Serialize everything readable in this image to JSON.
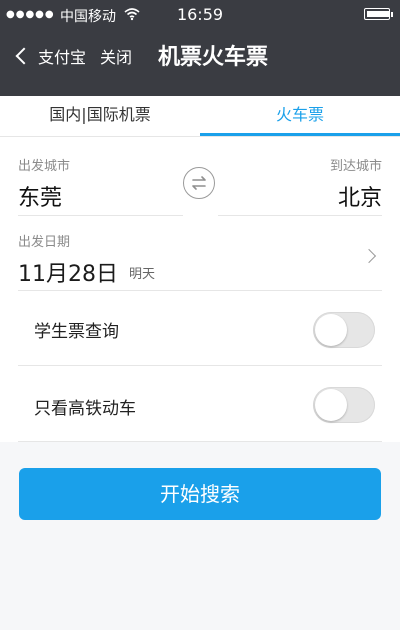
{
  "status_bar": {
    "signal_dots": "●●●●●",
    "carrier": "中国移动",
    "time": "16:59"
  },
  "nav": {
    "back_label": "支付宝",
    "close_label": "关闭",
    "title": "机票火车票"
  },
  "tabs": [
    {
      "label": "国内|国际机票",
      "active": false
    },
    {
      "label": "火车票",
      "active": true
    }
  ],
  "form": {
    "from_label": "出发城市",
    "from_value": "东莞",
    "to_label": "到达城市",
    "to_value": "北京",
    "date_label": "出发日期",
    "date_value": "11月28日",
    "date_hint": "明天",
    "student_label": "学生票查询",
    "highspeed_label": "只看高铁动车"
  },
  "toggles": {
    "student": false,
    "highspeed": false
  },
  "actions": {
    "search_label": "开始搜索"
  },
  "colors": {
    "accent": "#1aa0ea",
    "nav_bg": "#3a3c42"
  }
}
